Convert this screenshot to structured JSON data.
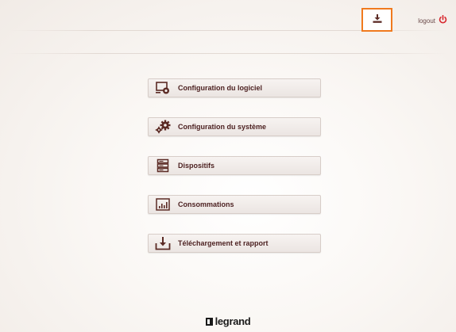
{
  "header": {
    "download_icon": "download-icon",
    "logout_label": "logout",
    "logout_icon": "power-icon",
    "accent_color": "#f07a1e",
    "logout_icon_color": "#d8282f"
  },
  "menu": {
    "items": [
      {
        "label": "Configuration du logiciel",
        "icon": "software-config-icon"
      },
      {
        "label": "Configuration du système",
        "icon": "gears-icon"
      },
      {
        "label": "Dispositifs",
        "icon": "devices-stack-icon"
      },
      {
        "label": "Consommations",
        "icon": "chart-icon"
      },
      {
        "label": "Téléchargement et rapport",
        "icon": "download-report-icon"
      }
    ]
  },
  "footer": {
    "logo_text": "legrand"
  }
}
